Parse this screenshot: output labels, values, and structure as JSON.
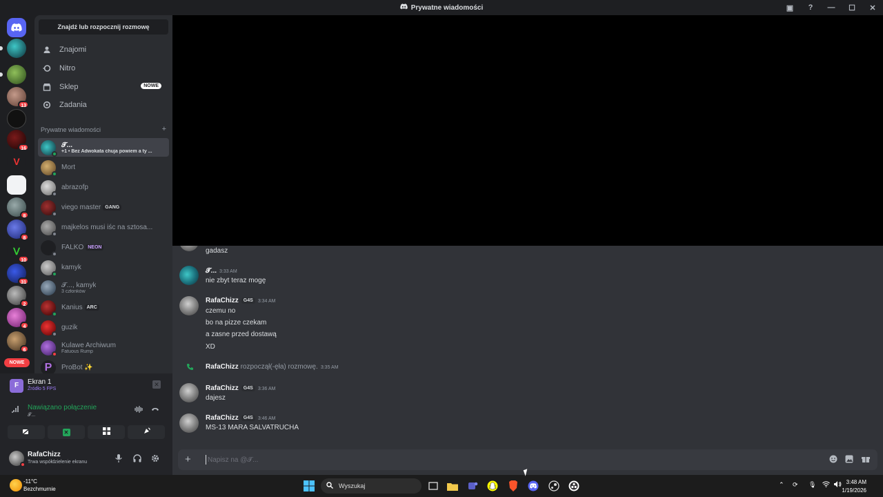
{
  "window": {
    "title": "Prywatne wiadomości"
  },
  "dm_panel": {
    "find_button": "Znajdź lub rozpocznij rozmowę",
    "nav": [
      {
        "label": "Znajomi",
        "icon": "friends-icon"
      },
      {
        "label": "Nitro",
        "icon": "nitro-icon"
      },
      {
        "label": "Sklep",
        "icon": "shop-icon",
        "badge": "NOWE"
      },
      {
        "label": "Zadania",
        "icon": "quests-icon"
      }
    ],
    "section_title": "Prywatne wiadomości",
    "dms": [
      {
        "name": "𝓣...",
        "sub": "+1 • Bez Adwokata chuja powiem a ty ...",
        "status": "on",
        "active": true
      },
      {
        "name": "Mort",
        "sub": "",
        "status": "on"
      },
      {
        "name": "abrazofp",
        "sub": "",
        "status": "off"
      },
      {
        "name": "viego master",
        "tag": "GANG",
        "sub": "",
        "status": "off"
      },
      {
        "name": "majkelos musi iśc na sztosa...",
        "sub": "",
        "status": "off"
      },
      {
        "name": "FALKO",
        "tag": "NEON",
        "sub": "",
        "status": "off"
      },
      {
        "name": "kamyk",
        "sub": "",
        "status": "on"
      },
      {
        "name": "𝓣..., kamyk",
        "sub": "3 członków",
        "status": "none"
      },
      {
        "name": "Kanius",
        "tag": "ARC",
        "sub": "",
        "status": "on"
      },
      {
        "name": "guzik",
        "sub": "",
        "status": "off"
      },
      {
        "name": "Kulawe Archiwum",
        "sub": "Fatuous Rump",
        "status": "dnd"
      },
      {
        "name": "ProBot ✨",
        "sub": "",
        "status": "none"
      }
    ]
  },
  "server_rail": {
    "badges": [
      "13",
      "16",
      "8",
      "8",
      "10",
      "31",
      "2",
      "4",
      "6"
    ],
    "nowe_label": "NOWE"
  },
  "user_panel": {
    "screen_title": "Ekran 1",
    "screen_sub": "Źródło 5 FPS",
    "screen_thumb_letter": "F",
    "voice_status": "Nawiązano połączenie",
    "voice_channel": "𝓣...",
    "username": "RafaChizz",
    "user_status": "Trwa współdzielenie ekranu"
  },
  "chat": {
    "messages": [
      {
        "author": "",
        "lines": [
          "gadasz"
        ]
      },
      {
        "author": "𝓣...",
        "time": "3:33 AM",
        "lines": [
          "nie zbyt teraz mogę"
        ]
      },
      {
        "author": "RafaChizz",
        "tag": "G4S",
        "time": "3:34 AM",
        "lines": [
          "czemu no",
          "bo na pizze czekam",
          "a zasne przed dostawą",
          "XD"
        ]
      },
      {
        "author": "RafaChizz",
        "system": "rozpoczął(-ęła) rozmowę.",
        "time": "3:35 AM"
      },
      {
        "author": "RafaChizz",
        "tag": "G4S",
        "time": "3:36 AM",
        "lines": [
          "dajesz"
        ]
      },
      {
        "author": "RafaChizz",
        "tag": "G4S",
        "time": "3:46 AM",
        "lines": [
          "MS-13 MARA SALVATRUCHA"
        ]
      }
    ],
    "composer_placeholder": "Napisz na @𝓣..."
  },
  "taskbar": {
    "temperature": "-11°C",
    "weather": "Bezchmurnie",
    "search_label": "Wyszukaj",
    "time": "3:48 AM",
    "date": "1/19/2026"
  }
}
